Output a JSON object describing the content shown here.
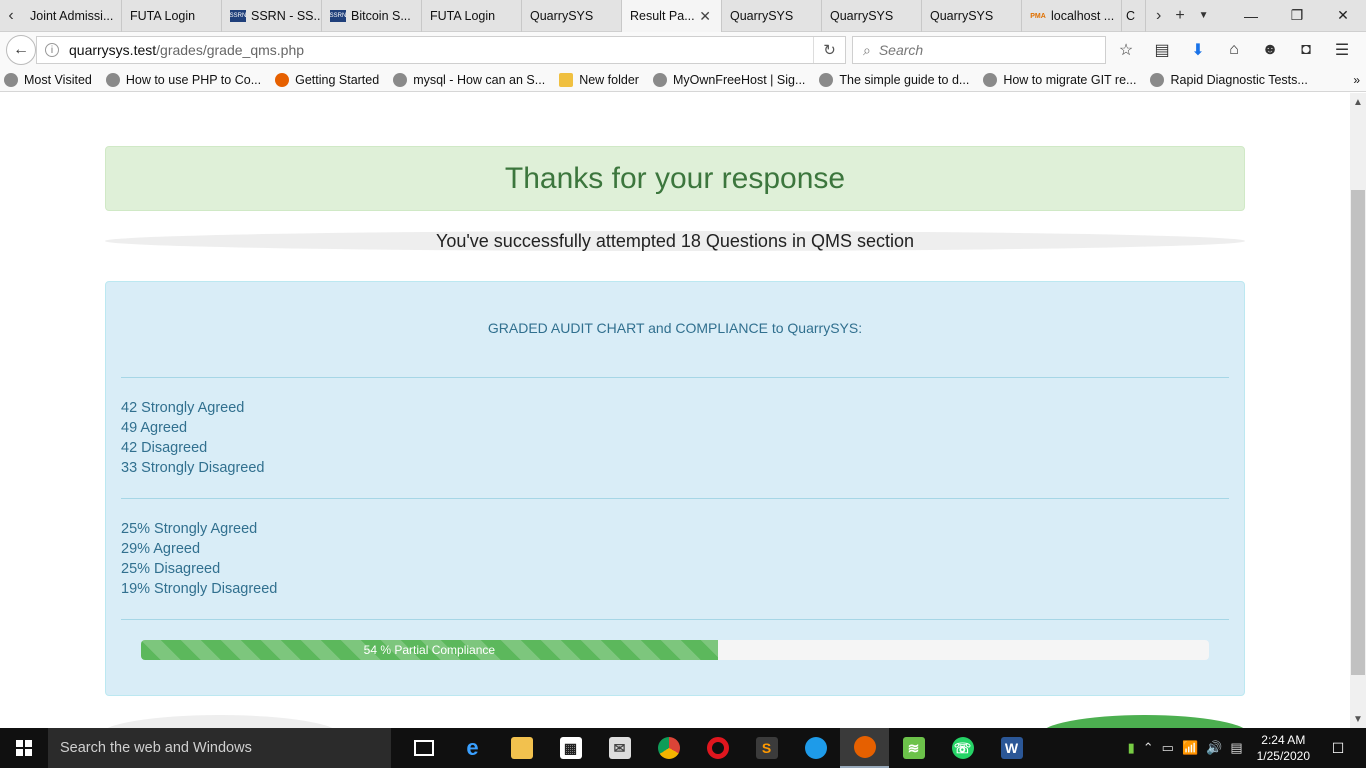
{
  "browser": {
    "tabs": [
      {
        "label": "Joint Admissi...",
        "active": false
      },
      {
        "label": "FUTA Login",
        "active": false
      },
      {
        "label": "SSRN - SS...",
        "active": false,
        "favicon": "SSRN"
      },
      {
        "label": "Bitcoin S...",
        "active": false,
        "favicon": "SSRN"
      },
      {
        "label": "FUTA Login",
        "active": false
      },
      {
        "label": "QuarrySYS",
        "active": false
      },
      {
        "label": "Result Pa...",
        "active": true
      },
      {
        "label": "QuarrySYS",
        "active": false
      },
      {
        "label": "QuarrySYS",
        "active": false
      },
      {
        "label": "QuarrySYS",
        "active": false
      },
      {
        "label": "localhost ...",
        "active": false,
        "favicon": "PMA"
      },
      {
        "label": "C",
        "active": false
      }
    ],
    "url_host": "quarrysys.test",
    "url_path": "/grades/grade_qms.php",
    "search_placeholder": "Search",
    "bookmarks": [
      {
        "label": "Most Visited",
        "icon": "gear-icon"
      },
      {
        "label": "How to use PHP to Co...",
        "icon": "globe-icon"
      },
      {
        "label": "Getting Started",
        "icon": "firefox-icon"
      },
      {
        "label": "mysql - How can an S...",
        "icon": "globe-icon"
      },
      {
        "label": "New folder",
        "icon": "folder-icon"
      },
      {
        "label": "MyOwnFreeHost | Sig...",
        "icon": "globe-icon"
      },
      {
        "label": "The simple guide to d...",
        "icon": "globe-icon"
      },
      {
        "label": "How to migrate GIT re...",
        "icon": "globe-icon"
      },
      {
        "label": "Rapid Diagnostic Tests...",
        "icon": "globe-icon"
      }
    ]
  },
  "page": {
    "success_message": "Thanks for your response",
    "attempt_message": "You've successfully attempted 18 Questions in QMS section",
    "chart_title": "GRADED AUDIT CHART and COMPLIANCE to QuarrySYS:",
    "counts": [
      "42 Strongly Agreed",
      "49 Agreed",
      "42 Disagreed",
      "33 Strongly Disagreed"
    ],
    "percentages": [
      "25% Strongly Agreed",
      "29% Agreed",
      "25% Disagreed",
      "19% Strongly Disagreed"
    ],
    "compliance": {
      "label": "54 % Partial Compliance",
      "value_percent": 54
    }
  },
  "taskbar": {
    "search_placeholder": "Search the web and Windows",
    "time": "2:24 AM",
    "date": "1/25/2020"
  }
}
